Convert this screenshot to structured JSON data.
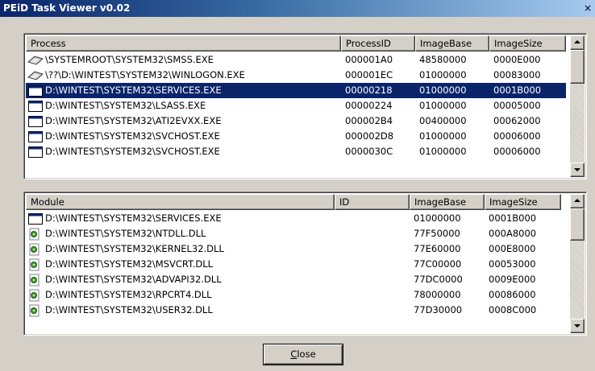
{
  "window": {
    "title": "PEiD Task Viewer v0.02",
    "close_glyph": "×"
  },
  "process_list": {
    "columns": [
      "Process",
      "ProcessID",
      "ImageBase",
      "ImageSize"
    ],
    "rows": [
      {
        "icon": "system-process-icon",
        "name": "\\SYSTEMROOT\\SYSTEM32\\SMSS.EXE",
        "pid": "000001A0",
        "base": "48580000",
        "size": "0000E000",
        "selected": false
      },
      {
        "icon": "system-process-icon",
        "name": "\\??\\D:\\WINTEST\\SYSTEM32\\WINLOGON.EXE",
        "pid": "000001EC",
        "base": "01000000",
        "size": "00083000",
        "selected": false
      },
      {
        "icon": "window-app-icon",
        "name": "D:\\WINTEST\\SYSTEM32\\SERVICES.EXE",
        "pid": "00000218",
        "base": "01000000",
        "size": "0001B000",
        "selected": true
      },
      {
        "icon": "window-app-icon",
        "name": "D:\\WINTEST\\SYSTEM32\\LSASS.EXE",
        "pid": "00000224",
        "base": "01000000",
        "size": "00005000",
        "selected": false
      },
      {
        "icon": "window-app-icon",
        "name": "D:\\WINTEST\\SYSTEM32\\ATI2EVXX.EXE",
        "pid": "000002B4",
        "base": "00400000",
        "size": "00062000",
        "selected": false
      },
      {
        "icon": "window-app-icon",
        "name": "D:\\WINTEST\\SYSTEM32\\SVCHOST.EXE",
        "pid": "000002D8",
        "base": "01000000",
        "size": "00006000",
        "selected": false
      },
      {
        "icon": "window-app-icon",
        "name": "D:\\WINTEST\\SYSTEM32\\SVCHOST.EXE",
        "pid": "0000030C",
        "base": "01000000",
        "size": "00006000",
        "selected": false
      }
    ]
  },
  "module_list": {
    "columns": [
      "Module",
      "ID",
      "ImageBase",
      "ImageSize"
    ],
    "rows": [
      {
        "icon": "window-app-icon",
        "name": "D:\\WINTEST\\SYSTEM32\\SERVICES.EXE",
        "id": "",
        "base": "01000000",
        "size": "0001B000"
      },
      {
        "icon": "dll-gear-icon",
        "name": "D:\\WINTEST\\SYSTEM32\\NTDLL.DLL",
        "id": "",
        "base": "77F50000",
        "size": "000A8000"
      },
      {
        "icon": "dll-gear-icon",
        "name": "D:\\WINTEST\\SYSTEM32\\KERNEL32.DLL",
        "id": "",
        "base": "77E60000",
        "size": "000E8000"
      },
      {
        "icon": "dll-gear-icon",
        "name": "D:\\WINTEST\\SYSTEM32\\MSVCRT.DLL",
        "id": "",
        "base": "77C00000",
        "size": "00053000"
      },
      {
        "icon": "dll-gear-icon",
        "name": "D:\\WINTEST\\SYSTEM32\\ADVAPI32.DLL",
        "id": "",
        "base": "77DC0000",
        "size": "0009E000"
      },
      {
        "icon": "dll-gear-icon",
        "name": "D:\\WINTEST\\SYSTEM32\\RPCRT4.DLL",
        "id": "",
        "base": "78000000",
        "size": "00086000"
      },
      {
        "icon": "dll-gear-icon",
        "name": "D:\\WINTEST\\SYSTEM32\\USER32.DLL",
        "id": "",
        "base": "77D30000",
        "size": "0008C000"
      }
    ]
  },
  "close_button": {
    "mnemonic": "C",
    "rest": "lose"
  },
  "colors": {
    "selection": "#0a246a",
    "face": "#d4d0c8",
    "title_start": "#0a246a",
    "title_end": "#a6caf0"
  }
}
